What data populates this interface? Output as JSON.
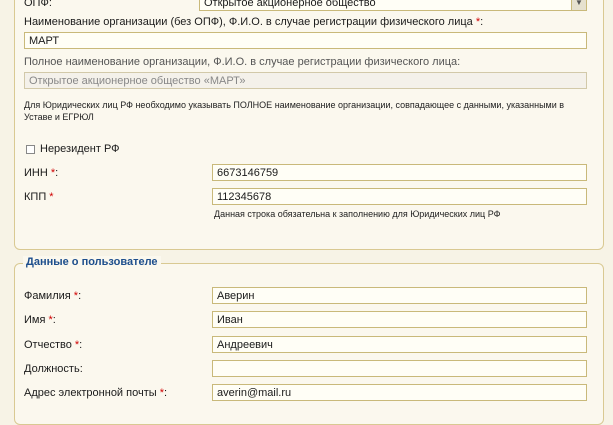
{
  "org": {
    "opf_label": "ОПФ:",
    "opf_value": "Открытое акционерное общество",
    "name_label": "Наименование организации (без ОПФ), Ф.И.О. в случае регистрации физического лица",
    "name_value": "МАРТ",
    "fullname_label": "Полное наименование организации, Ф.И.О. в случае регистрации физического лица:",
    "fullname_value": "Открытое акционерное общество «МАРТ»",
    "legal_note": "Для Юридических лиц РФ необходимо указывать ПОЛНОЕ наименование организации, совпадающее с данными, указанными в Уставе и ЕГРЮЛ",
    "nonresident_label": "Нерезидент РФ",
    "inn_label": "ИНН",
    "inn_value": "6673146759",
    "kpp_label": "КПП",
    "kpp_value": "112345678",
    "kpp_note": "Данная строка обязательна к заполнению для Юридических лиц РФ",
    "required_mark": "*"
  },
  "user": {
    "legend": "Данные о пользователе",
    "surname_label": "Фамилия",
    "surname_value": "Аверин",
    "firstname_label": "Имя",
    "firstname_value": "Иван",
    "patronymic_label": "Отчество",
    "patronymic_value": "Андреевич",
    "position_label": "Должность:",
    "position_value": "",
    "email_label": "Адрес электронной почты",
    "email_value": "averin@mail.ru"
  }
}
